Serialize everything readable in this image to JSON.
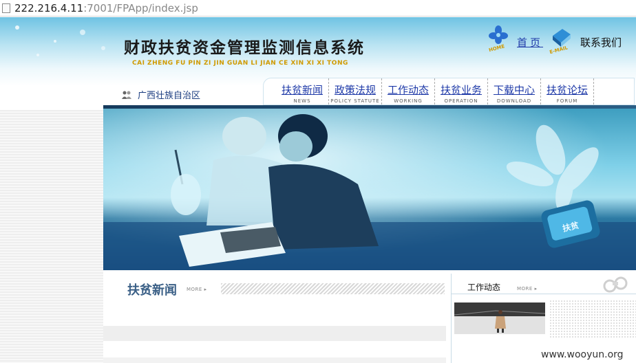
{
  "browser": {
    "url_host": "222.216.4.11",
    "url_path": ":7001/FPApp/index.jsp"
  },
  "header": {
    "title": "财政扶贫资金管理监测信息系统",
    "pinyin": "CAI ZHENG FU PIN ZI JIN GUAN LI JIAN CE XIN XI XI TONG",
    "home_label": "首页",
    "home_icon_text": "HOME",
    "email_icon_text": "E-MAIL",
    "contact_label": "联系我们",
    "region": "广西壮族自治区"
  },
  "nav": {
    "items": [
      {
        "zh": "扶贫新闻",
        "en": "NEWS"
      },
      {
        "zh": "政策法规",
        "en": "POLICY STATUTE"
      },
      {
        "zh": "工作动态",
        "en": "WORKING"
      },
      {
        "zh": "扶贫业务",
        "en": "OPERATION"
      },
      {
        "zh": "下载中心",
        "en": "DOWNLOAD"
      },
      {
        "zh": "扶贫论坛",
        "en": "FORUM"
      }
    ]
  },
  "banner": {
    "badge_text": "扶贫"
  },
  "news": {
    "title": "扶贫新闻",
    "more": "MORE"
  },
  "work": {
    "title": "工作动态",
    "more": "MORE"
  },
  "watermark": "www.wooyun.org"
}
